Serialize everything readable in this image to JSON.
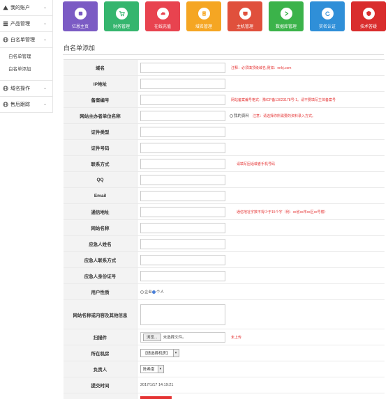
{
  "sidebar": {
    "items": [
      {
        "label": "我的账户"
      },
      {
        "label": "产品管理"
      },
      {
        "label": "白名单管理"
      },
      {
        "label": "域名操作"
      },
      {
        "label": "售后跟踪"
      }
    ],
    "sub_items": [
      {
        "label": "白名单管理"
      },
      {
        "label": "白名单添加"
      }
    ]
  },
  "tiles": [
    {
      "label": "亿恩主页",
      "color": "#7b5bc4"
    },
    {
      "label": "财务管理",
      "color": "#35b56e"
    },
    {
      "label": "在线充值",
      "color": "#e8434f"
    },
    {
      "label": "域名管理",
      "color": "#f5a623"
    },
    {
      "label": "主机管理",
      "color": "#e0503c"
    },
    {
      "label": "数据库管理",
      "color": "#3bb34a"
    },
    {
      "label": "实名认证",
      "color": "#2f8fd8"
    },
    {
      "label": "技术答疑",
      "color": "#d92d2d"
    }
  ],
  "page_title": "白名单添加",
  "form": {
    "domain_label": "域名",
    "domain_note": "注释：必须填顶级域名,例如：enkj.com",
    "ip_label": "IP地址",
    "beian_label": "备案编号",
    "beian_note": "网站备案编号格式：豫ICP备13023178号-1。请不要填写主体备案号",
    "host_label": "网站主办者单位名称",
    "my_info": "我的资料",
    "host_note": "注意：请选择你所需要的资料录入方式。",
    "cert_type_label": "证件类型",
    "cert_no_label": "证件号码",
    "contact_label": "联系方式",
    "contact_note": "请填写固话或者手机号码",
    "qq_label": "QQ",
    "email_label": "Email",
    "address_label": "通信地址",
    "address_note": "通信地址字数不得少于15个字（例：xx省xx市xx区xx号楼）",
    "site_name_label": "网站名称",
    "emer_name_label": "应急人姓名",
    "emer_contact_label": "应急人联系方式",
    "emer_id_label": "应急人身份证号",
    "user_type_label": "用户性质",
    "user_type_enterprise": "企业",
    "user_type_personal": "个人",
    "site_content_label": "网站名称或内容及其他信息",
    "scan_label": "扫描件",
    "browse_button": "浏览...",
    "no_file": "未选择文件。",
    "scan_note": "未上传",
    "room_label": "所在机房",
    "room_select": "【请选择机房】",
    "owner_label": "负责人",
    "owner_select": "陈希南",
    "submit_time_label": "提交时间",
    "submit_time_value": "2017/1/17 14:19:21",
    "save_button": "保存"
  }
}
